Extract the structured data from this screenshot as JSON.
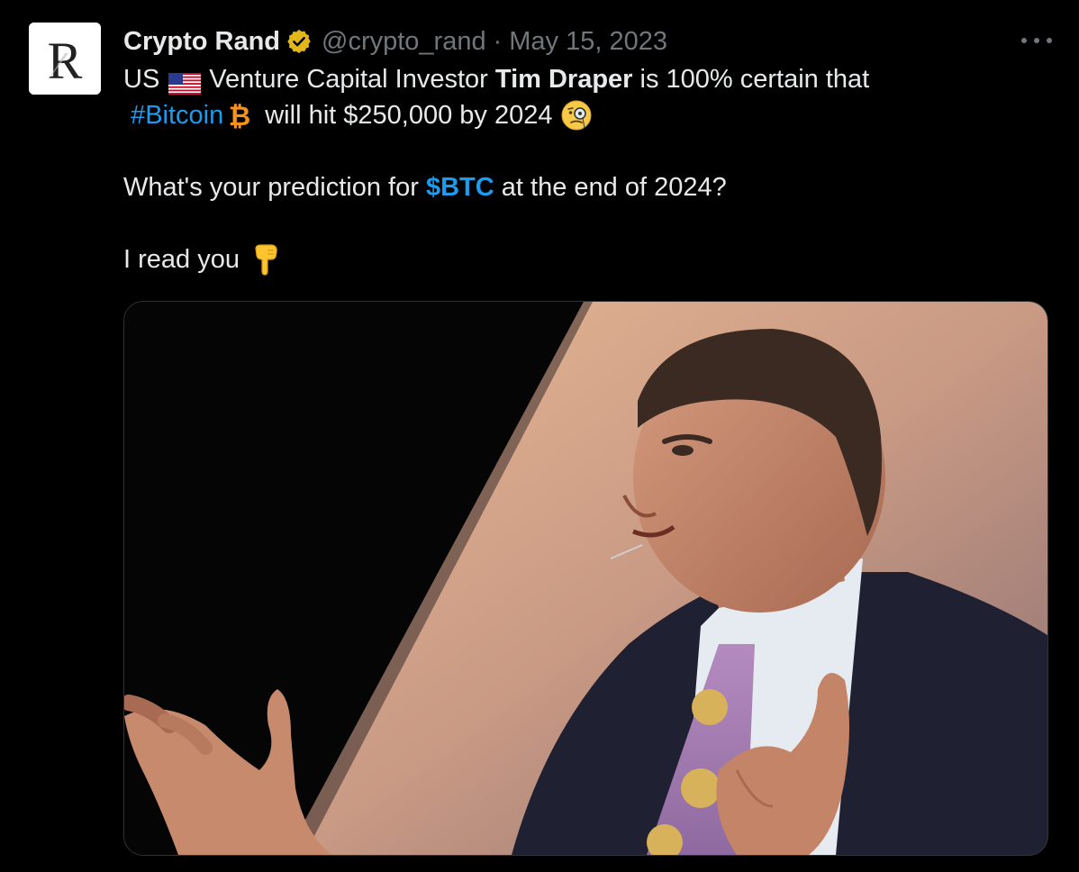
{
  "tweet": {
    "display_name": "Crypto Rand",
    "handle": "@crypto_rand",
    "separator": "·",
    "date": "May 15, 2023",
    "avatar_letter": "R",
    "line1": {
      "prefix": "US",
      "text_a": "Venture Capital Investor",
      "bold_name": "Tim Draper",
      "text_b": "is 100% certain that"
    },
    "line2": {
      "hashtag": "#Bitcoin",
      "text": "will hit $250,000 by 2024"
    },
    "line3": {
      "text_a": "What's your prediction for",
      "cashtag": "$BTC",
      "text_b": "at the end of 2024?"
    },
    "line4": {
      "text": "I read you"
    },
    "icons": {
      "verified": "verified-badge-icon",
      "flag": "us-flag-icon",
      "bitcoin": "bitcoin-icon",
      "monocle": "face-with-monocle-icon",
      "pointing": "backhand-index-pointing-down-icon",
      "more": "more-options-icon"
    },
    "colors": {
      "background": "#000000",
      "text": "#e7e9ea",
      "secondary": "#71767b",
      "link": "#1d9bf0",
      "verified": "#e2b719"
    }
  }
}
